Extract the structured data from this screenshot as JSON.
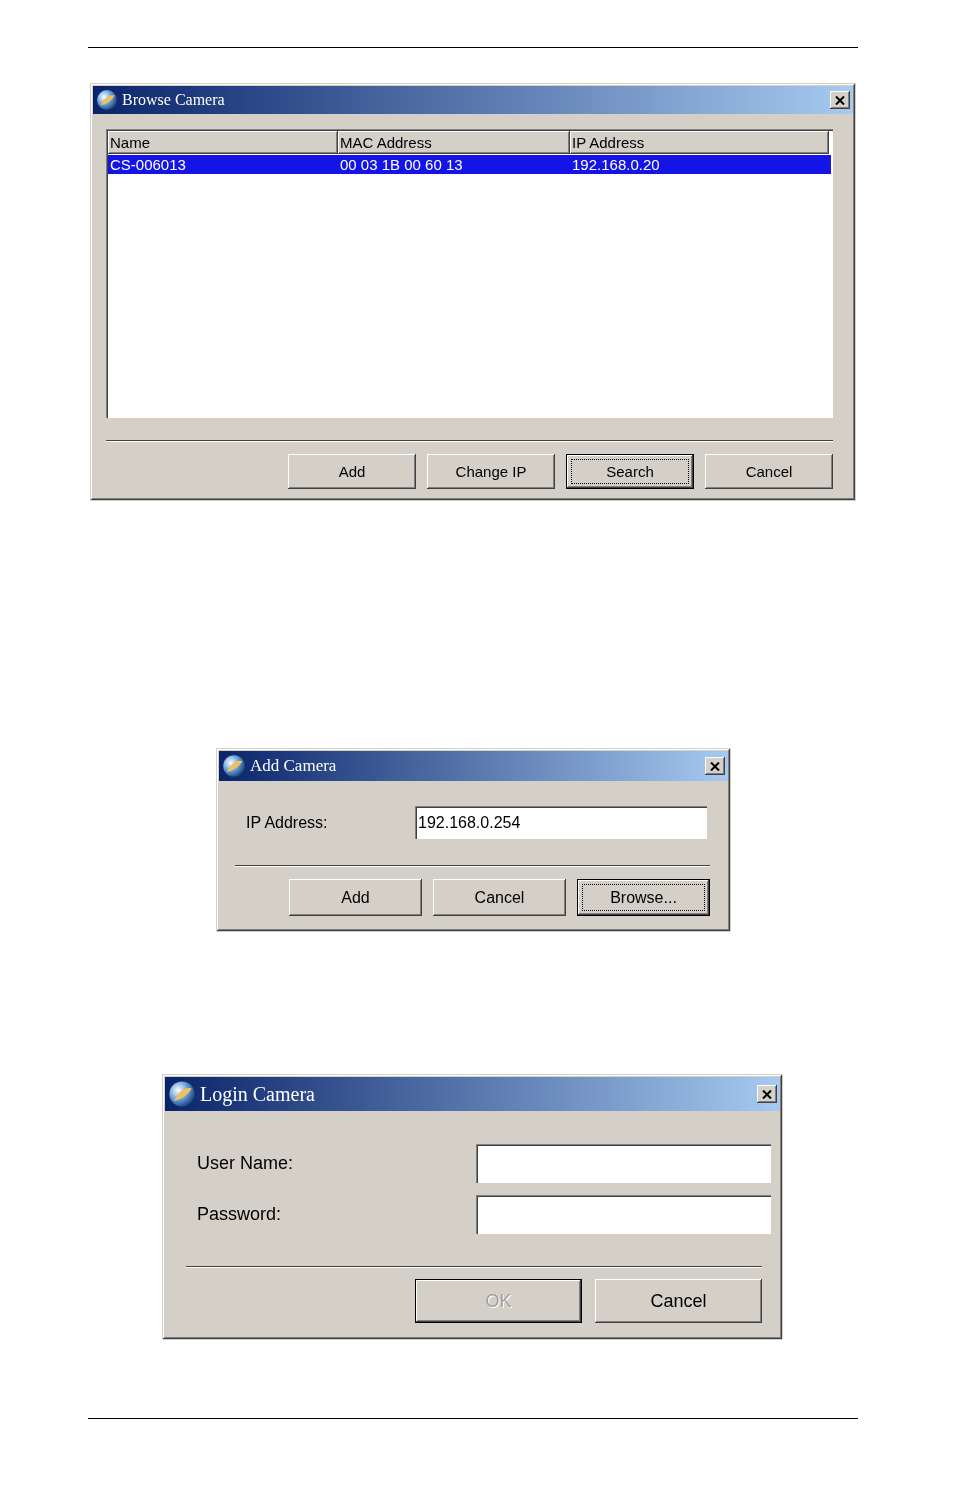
{
  "dialogs": [
    {
      "kind": "list",
      "title": "Browse Camera",
      "list": {
        "columns": [
          "Name",
          "MAC Address",
          "IP Address"
        ],
        "rows": [
          {
            "cells": [
              "CS-006013",
              "00 03 1B 00 60 13",
              "192.168.0.20"
            ],
            "selected": true
          }
        ]
      },
      "buttons": [
        {
          "label": "Add",
          "default": false,
          "disabled": false
        },
        {
          "label": "Change IP",
          "default": false,
          "disabled": false
        },
        {
          "label": "Search",
          "default": true,
          "disabled": false
        },
        {
          "label": "Cancel",
          "default": false,
          "disabled": false
        }
      ]
    },
    {
      "kind": "form",
      "title": "Add Camera",
      "fields": [
        {
          "label": "IP Address:",
          "value": "192.168.0.254"
        }
      ],
      "buttons": [
        {
          "label": "Add",
          "default": false,
          "disabled": false
        },
        {
          "label": "Cancel",
          "default": false,
          "disabled": false
        },
        {
          "label": "Browse...",
          "default": true,
          "disabled": false
        }
      ]
    },
    {
      "kind": "form",
      "title": "Login Camera",
      "fields": [
        {
          "label": "User Name:"
        },
        {
          "label": "Password:"
        }
      ],
      "buttons": [
        {
          "label": "OK",
          "default": true,
          "disabled": true
        },
        {
          "label": "Cancel",
          "default": false,
          "disabled": false
        }
      ]
    }
  ]
}
